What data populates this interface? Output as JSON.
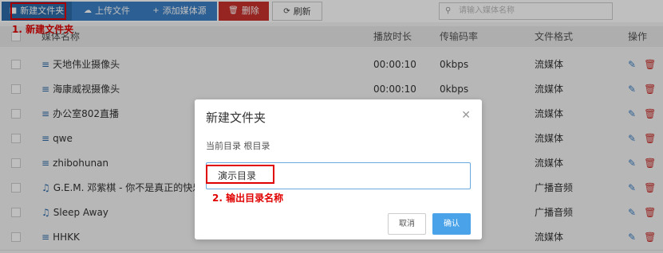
{
  "toolbar": {
    "new_folder": "新建文件夹",
    "upload": "上传文件",
    "add_source": "添加媒体源",
    "delete": "删除",
    "refresh": "刷新",
    "search_placeholder": "请输入媒体名称"
  },
  "annotations": {
    "step1": "1. 新建文件夹",
    "step2": "2. 输出目录名称"
  },
  "table": {
    "headers": [
      "媒体名称",
      "播放时长",
      "传输码率",
      "文件格式",
      "操作"
    ],
    "rows": [
      {
        "icon": "stream-icon",
        "name": "天地伟业摄像头",
        "duration": "00:00:10",
        "bitrate": "0kbps",
        "format": "流媒体"
      },
      {
        "icon": "stream-icon",
        "name": "海康威视摄像头",
        "duration": "00:00:10",
        "bitrate": "0kbps",
        "format": "流媒体"
      },
      {
        "icon": "stream-icon",
        "name": "办公室802直播",
        "duration": "",
        "bitrate": "",
        "format": "流媒体"
      },
      {
        "icon": "stream-icon",
        "name": "qwe",
        "duration": "",
        "bitrate": "",
        "format": "流媒体"
      },
      {
        "icon": "stream-icon",
        "name": "zhibohunan",
        "duration": "",
        "bitrate": "",
        "format": "流媒体"
      },
      {
        "icon": "music-icon",
        "name": "G.E.M. 邓紫棋 - 你不是真正的快乐",
        "duration": "",
        "bitrate": "",
        "format": "广播音频"
      },
      {
        "icon": "music-icon",
        "name": "Sleep Away",
        "duration": "",
        "bitrate": "",
        "format": "广播音频"
      },
      {
        "icon": "stream-icon",
        "name": "HHKK",
        "duration": "",
        "bitrate": "",
        "format": "流媒体"
      }
    ]
  },
  "dialog": {
    "title": "新建文件夹",
    "current_dir": "当前目录 根目录",
    "input_value": "演示目录",
    "cancel": "取消",
    "confirm": "确认"
  }
}
